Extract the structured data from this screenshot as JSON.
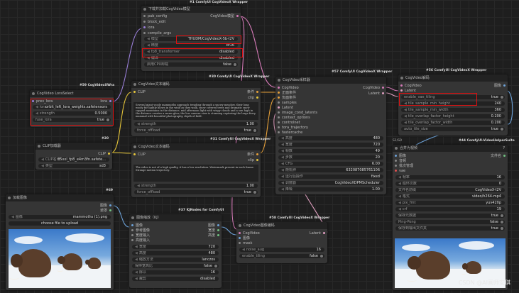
{
  "nodes": {
    "loader": {
      "tag": "#1 ComfyUI CogVideoX Wrapper",
      "title": "下载并加载CogVideo模型",
      "inputs": [
        "pab_config",
        "block_edit",
        "lora",
        "compile_args"
      ],
      "output": "CogVideo模型",
      "widgets": [
        {
          "label": "模型",
          "value": "THUDM/CogVideoX-5b-I2V"
        },
        {
          "label": "精度",
          "value": "bf16"
        },
        {
          "label": "fp8_transformer",
          "value": "disabled"
        },
        {
          "label": "编译",
          "value": "disabled"
        },
        {
          "label": "启用CPU卸载",
          "value": "false"
        }
      ]
    },
    "lora": {
      "tag": "#59 CogVideoXWra",
      "tag_num": "#59",
      "title": "CogVideo LoraSelect",
      "input": "prev_lora",
      "output": "lora",
      "widgets": [
        {
          "label": "lora",
          "value": "orbit_left_lora_weights.safetensors"
        },
        {
          "label": "strength",
          "value": "0.5000"
        },
        {
          "label": "fuse_lora",
          "value": "true"
        }
      ]
    },
    "clip_loader": {
      "tag": "#20",
      "title": "CLIP加载器",
      "output": "CLIP",
      "widgets": [
        {
          "label": "CLIP名称",
          "value": "t5xxl_fp8_e4m3fn.safete..."
        },
        {
          "label": "类型",
          "value": "sd3"
        }
      ]
    },
    "text_pos": {
      "tag": "#30 ComfyUI CogVideoX Wrapper",
      "title": "CogVideo文本编码",
      "input": "CLIP",
      "outputs": [
        "条件",
        "clip"
      ],
      "text": "Several giant wooly mammoths approach treading through a snowy meadow, their long wooly fur lightly blows in the wind as they walk, snow covered trees and dramatic snow capped mountains in the distance, mid afternoon light with wispy clouds and a sun high in the distance creates a warm glow, the low camera view is stunning capturing the large furry mammal with beautiful photography, depth of field.",
      "widgets": [
        {
          "label": "strength",
          "value": "1.00"
        },
        {
          "label": "force_offload",
          "value": "true"
        }
      ]
    },
    "text_neg": {
      "tag": "#31 ComfyUI CogVideoX Wrapper",
      "title": "CogVideo文本编码",
      "input": "CLIP",
      "outputs": [
        "条件",
        "clip"
      ],
      "text": "The video is not of a high quality, it has a low resolution. Watermark present in each frame. Strange motion trajectory.",
      "widgets": [
        {
          "label": "strength",
          "value": "1.00"
        },
        {
          "label": "force_offload",
          "value": "true"
        }
      ]
    },
    "sampler": {
      "tag": "#57 ComfyUI CogVideoX Wrapper",
      "title": "CogVideo采样器",
      "inputs": [
        "CogVideo",
        "正面条件",
        "负面条件",
        "samples",
        "Latent",
        "image_cond_latents",
        "context_options",
        "controlnet",
        "tora_trajectory",
        "fastercache"
      ],
      "outputs": [
        "CogVideo",
        "Latent"
      ],
      "widgets": [
        {
          "label": "高度",
          "value": "480"
        },
        {
          "label": "宽度",
          "value": "720"
        },
        {
          "label": "帧数",
          "value": "49"
        },
        {
          "label": "步数",
          "value": "20"
        },
        {
          "label": "CFG",
          "value": "6.00"
        },
        {
          "label": "随机种",
          "value": "632087085761106"
        },
        {
          "label": "运行后操作",
          "value": "fixed"
        },
        {
          "label": "调度器",
          "value": "CogVideoXDPMScheduler"
        },
        {
          "label": "降噪",
          "value": "1.00"
        }
      ]
    },
    "decode": {
      "tag": "#56 ComfyUI CogVideoX Wrapper",
      "title": "CogVideo解码",
      "inputs": [
        "CogVideo",
        "Latent"
      ],
      "output": "图像",
      "widgets": [
        {
          "label": "enable_vae_tiling",
          "value": "true"
        },
        {
          "label": "tile_sample_min_height",
          "value": "240"
        },
        {
          "label": "tile_sample_min_width",
          "value": "360"
        },
        {
          "label": "tile_overlap_factor_height",
          "value": "0.200"
        },
        {
          "label": "tile_overlap_factor_width",
          "value": "0.200"
        },
        {
          "label": "auto_tile_size",
          "value": "true"
        }
      ]
    },
    "combine": {
      "tag": "#44 ComfyUI-VideoHelperSuite",
      "title": "合并为视频",
      "tag_side": "S1/S0",
      "inputs": [
        "图像",
        "音频",
        "批次管理",
        "vae"
      ],
      "output": "文件名",
      "widgets": [
        {
          "label": "帧率",
          "value": "16"
        },
        {
          "label": "循环次数",
          "value": "0"
        },
        {
          "label": "文件名前缀",
          "value": "CogVideoX-I2V"
        },
        {
          "label": "格式",
          "value": "video/h264-mp4"
        },
        {
          "label": "pix_fmt",
          "value": "yuv420p"
        },
        {
          "label": "crf",
          "value": "19"
        },
        {
          "label": "保存元数据",
          "value": "true"
        },
        {
          "label": "Ping-Pong",
          "value": "false"
        },
        {
          "label": "保存到输出文件夹",
          "value": "true"
        }
      ]
    },
    "load_image": {
      "tag": "#69",
      "title": "加载图像",
      "outputs": [
        "图像",
        "遮罩"
      ],
      "widgets": [
        {
          "label": "图像",
          "value": "mammoths (1).png"
        }
      ],
      "upload_label": "choose file to upload"
    },
    "resize": {
      "tag": "#37 KJNodes for ComfyUI",
      "title": "图像缩放（KJ）",
      "inputs": [
        "图像",
        "参考图像",
        "宽度输入",
        "高度输入"
      ],
      "outputs": [
        "图像",
        "宽度",
        "高度"
      ],
      "widgets": [
        {
          "label": "宽度",
          "value": "720"
        },
        {
          "label": "高度",
          "value": "480"
        },
        {
          "label": "缩放方法",
          "value": "lanczos"
        },
        {
          "label": "保持宽高比",
          "value": "false"
        },
        {
          "label": "除以",
          "value": "16"
        },
        {
          "label": "裁剪",
          "value": "disabled"
        }
      ]
    },
    "img_encode": {
      "tag": "#58 ComfyUI CogVideoX Wrapper",
      "title": "CogVideo图像编码",
      "inputs": [
        "CogVideo",
        "图像",
        "mask"
      ],
      "output": "Latent",
      "widgets": [
        {
          "label": "noise_aug",
          "value": "16"
        },
        {
          "label": "enable_tiling",
          "value": "false"
        }
      ]
    }
  },
  "watermark": "CSDN @AI画师安琪",
  "colors": {
    "highlight": "#e01010",
    "wire_yellow": "#e6c63a",
    "wire_pink": "#d67ab8",
    "wire_purple": "#9a7fd8",
    "wire_blue": "#6da2d8",
    "wire_green": "#70c080"
  }
}
